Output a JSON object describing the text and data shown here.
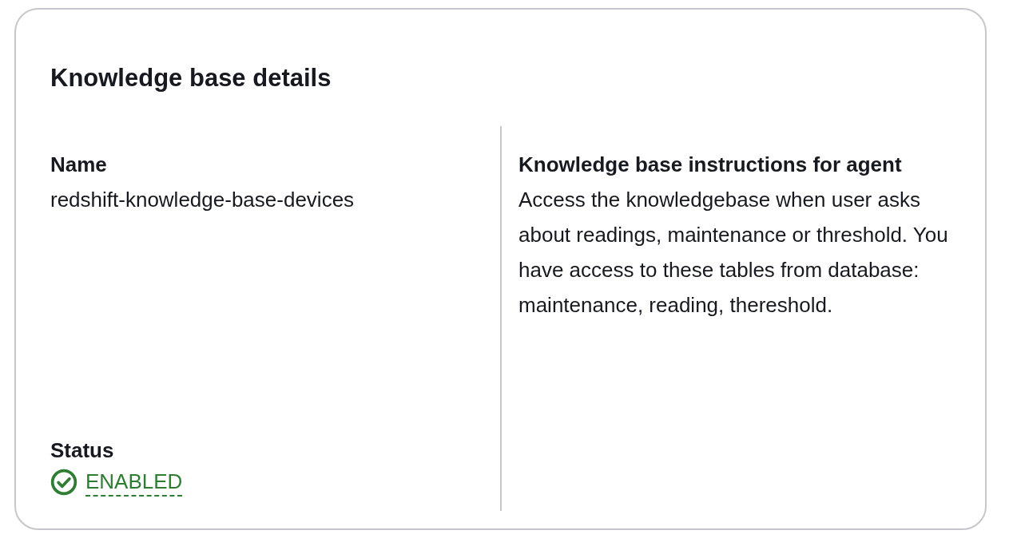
{
  "card": {
    "title": "Knowledge base details",
    "name": {
      "label": "Name",
      "value": "redshift-knowledge-base-devices"
    },
    "status": {
      "label": "Status",
      "value": "ENABLED",
      "kind": "success"
    },
    "instructions": {
      "label": "Knowledge base instructions for agent",
      "value": "Access the knowledgebase when user asks about readings, maintenance or threshold. You have access to these tables from database: maintenance, reading, thereshold."
    }
  }
}
